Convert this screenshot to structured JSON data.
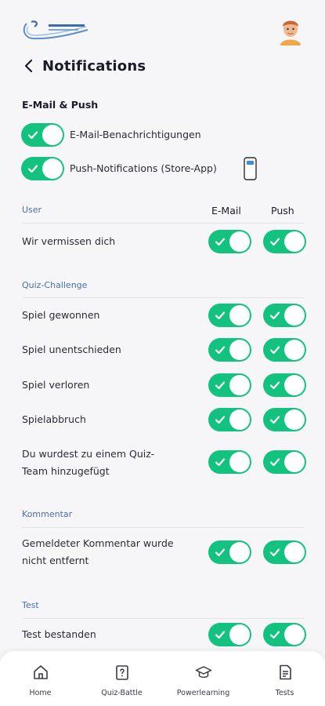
{
  "header": {
    "title": "Notifications"
  },
  "global": {
    "section_title": "E-Mail & Push",
    "email_label": "E-Mail-Benachrichtigungen",
    "push_label": "Push-Notifications (Store-App)",
    "email_enabled": true,
    "push_enabled": true
  },
  "columns": {
    "email": "E-Mail",
    "push": "Push"
  },
  "groups": [
    {
      "title": "User",
      "rows": [
        {
          "label": "Wir vermissen dich",
          "email": true,
          "push": true
        }
      ]
    },
    {
      "title": "Quiz-Challenge",
      "rows": [
        {
          "label": "Spiel gewonnen",
          "email": true,
          "push": true
        },
        {
          "label": "Spiel unentschieden",
          "email": true,
          "push": true
        },
        {
          "label": "Spiel verloren",
          "email": true,
          "push": true
        },
        {
          "label": "Spielabbruch",
          "email": true,
          "push": true
        },
        {
          "label": "Du wurdest zu einem Quiz-Team hinzugefügt",
          "email": true,
          "push": true
        }
      ]
    },
    {
      "title": "Kommentar",
      "rows": [
        {
          "label": "Gemeldeter Kommentar wurde nicht entfernt",
          "email": true,
          "push": true
        }
      ]
    },
    {
      "title": "Test",
      "rows": [
        {
          "label": "Test bestanden",
          "email": true,
          "push": true
        }
      ]
    }
  ],
  "nav": [
    {
      "label": "Home",
      "icon": "home-icon"
    },
    {
      "label": "Quiz-Battle",
      "icon": "quiz-battle-icon"
    },
    {
      "label": "Powerlearning",
      "icon": "graduation-cap-icon"
    },
    {
      "label": "Tests",
      "icon": "document-icon"
    }
  ],
  "colors": {
    "toggle_on": "#13c27f",
    "group_heading": "#4a6fae",
    "background": "#f6f6f8"
  }
}
